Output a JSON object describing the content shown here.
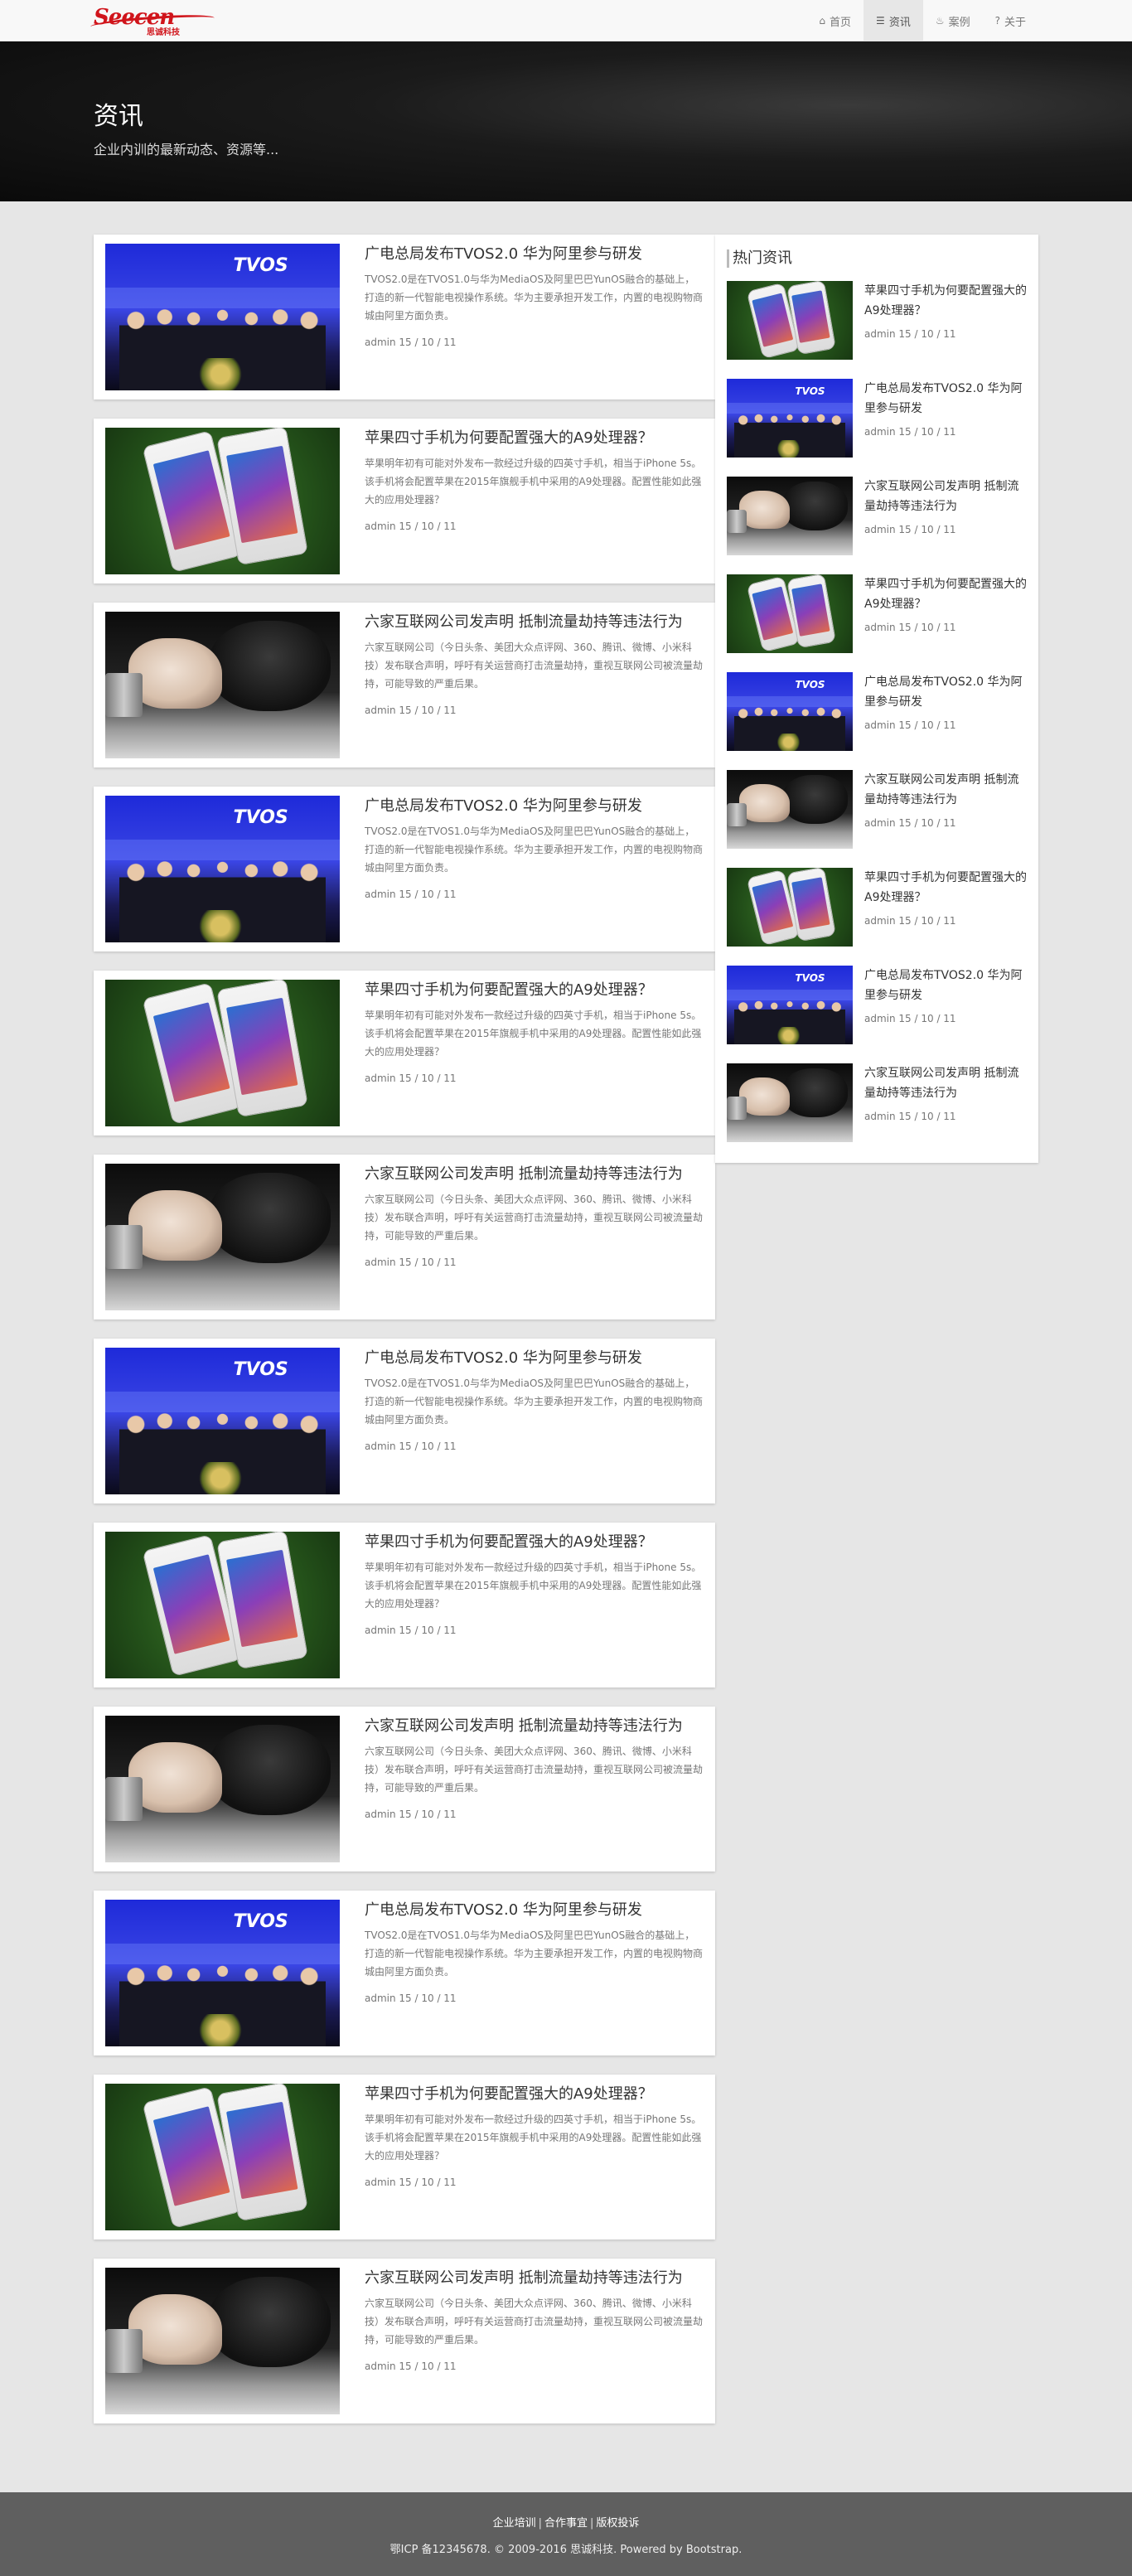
{
  "brand": {
    "logo_text": "Seecen",
    "logo_sub": "思诚科技"
  },
  "nav": [
    {
      "label": "首页",
      "icon": "home-icon",
      "glyph": "⌂"
    },
    {
      "label": "资讯",
      "icon": "list-icon",
      "glyph": "☰",
      "active": true
    },
    {
      "label": "案例",
      "icon": "fire-icon",
      "glyph": "♨"
    },
    {
      "label": "关于",
      "icon": "question-icon",
      "glyph": "?"
    }
  ],
  "hero": {
    "title": "资讯",
    "subtitle": "企业内训的最新动态、资源等..."
  },
  "articles": [
    {
      "image": "tv",
      "title": "广电总局发布TVOS2.0 华为阿里参与研发",
      "desc": "TVOS2.0是在TVOS1.0与华为MediaOS及阿里巴巴YunOS融合的基础上，打造的新一代智能电视操作系统。华为主要承担开发工作，内置的电视购物商城由阿里方面负责。",
      "meta": "admin 15 / 10 / 11"
    },
    {
      "image": "phone",
      "title": "苹果四寸手机为何要配置强大的A9处理器？",
      "desc": "苹果明年初有可能对外发布一款经过升级的四英寸手机，相当于iPhone 5s。该手机将会配置苹果在2015年旗舰手机中采用的A9处理器。配置性能如此强大的应用处理器？",
      "meta": "admin 15 / 10 / 11"
    },
    {
      "image": "hand",
      "title": "六家互联网公司发声明 抵制流量劫持等违法行为",
      "desc": "六家互联网公司（今日头条、美团大众点评网、360、腾讯、微博、小米科技）发布联合声明，呼吁有关运营商打击流量劫持，重视互联网公司被流量劫持，可能导致的严重后果。",
      "meta": "admin 15 / 10 / 11"
    },
    {
      "image": "tv",
      "title": "广电总局发布TVOS2.0 华为阿里参与研发",
      "desc": "TVOS2.0是在TVOS1.0与华为MediaOS及阿里巴巴YunOS融合的基础上，打造的新一代智能电视操作系统。华为主要承担开发工作，内置的电视购物商城由阿里方面负责。",
      "meta": "admin 15 / 10 / 11"
    },
    {
      "image": "phone",
      "title": "苹果四寸手机为何要配置强大的A9处理器？",
      "desc": "苹果明年初有可能对外发布一款经过升级的四英寸手机，相当于iPhone 5s。该手机将会配置苹果在2015年旗舰手机中采用的A9处理器。配置性能如此强大的应用处理器？",
      "meta": "admin 15 / 10 / 11"
    },
    {
      "image": "hand",
      "title": "六家互联网公司发声明 抵制流量劫持等违法行为",
      "desc": "六家互联网公司（今日头条、美团大众点评网、360、腾讯、微博、小米科技）发布联合声明，呼吁有关运营商打击流量劫持，重视互联网公司被流量劫持，可能导致的严重后果。",
      "meta": "admin 15 / 10 / 11"
    },
    {
      "image": "tv",
      "title": "广电总局发布TVOS2.0 华为阿里参与研发",
      "desc": "TVOS2.0是在TVOS1.0与华为MediaOS及阿里巴巴YunOS融合的基础上，打造的新一代智能电视操作系统。华为主要承担开发工作，内置的电视购物商城由阿里方面负责。",
      "meta": "admin 15 / 10 / 11"
    },
    {
      "image": "phone",
      "title": "苹果四寸手机为何要配置强大的A9处理器？",
      "desc": "苹果明年初有可能对外发布一款经过升级的四英寸手机，相当于iPhone 5s。该手机将会配置苹果在2015年旗舰手机中采用的A9处理器。配置性能如此强大的应用处理器？",
      "meta": "admin 15 / 10 / 11"
    },
    {
      "image": "hand",
      "title": "六家互联网公司发声明 抵制流量劫持等违法行为",
      "desc": "六家互联网公司（今日头条、美团大众点评网、360、腾讯、微博、小米科技）发布联合声明，呼吁有关运营商打击流量劫持，重视互联网公司被流量劫持，可能导致的严重后果。",
      "meta": "admin 15 / 10 / 11"
    },
    {
      "image": "tv",
      "title": "广电总局发布TVOS2.0 华为阿里参与研发",
      "desc": "TVOS2.0是在TVOS1.0与华为MediaOS及阿里巴巴YunOS融合的基础上，打造的新一代智能电视操作系统。华为主要承担开发工作，内置的电视购物商城由阿里方面负责。",
      "meta": "admin 15 / 10 / 11"
    },
    {
      "image": "phone",
      "title": "苹果四寸手机为何要配置强大的A9处理器？",
      "desc": "苹果明年初有可能对外发布一款经过升级的四英寸手机，相当于iPhone 5s。该手机将会配置苹果在2015年旗舰手机中采用的A9处理器。配置性能如此强大的应用处理器？",
      "meta": "admin 15 / 10 / 11"
    },
    {
      "image": "hand",
      "title": "六家互联网公司发声明 抵制流量劫持等违法行为",
      "desc": "六家互联网公司（今日头条、美团大众点评网、360、腾讯、微博、小米科技）发布联合声明，呼吁有关运营商打击流量劫持，重视互联网公司被流量劫持，可能导致的严重后果。",
      "meta": "admin 15 / 10 / 11"
    }
  ],
  "sidebar": {
    "title": "热门资讯",
    "items": [
      {
        "image": "phone",
        "title": "苹果四寸手机为何要配置强大的A9处理器？",
        "meta": "admin 15 / 10 / 11"
      },
      {
        "image": "tv",
        "title": "广电总局发布TVOS2.0 华为阿里参与研发",
        "meta": "admin 15 / 10 / 11"
      },
      {
        "image": "hand",
        "title": "六家互联网公司发声明 抵制流量劫持等违法行为",
        "meta": "admin 15 / 10 / 11"
      },
      {
        "image": "phone",
        "title": "苹果四寸手机为何要配置强大的A9处理器？",
        "meta": "admin 15 / 10 / 11"
      },
      {
        "image": "tv",
        "title": "广电总局发布TVOS2.0 华为阿里参与研发",
        "meta": "admin 15 / 10 / 11"
      },
      {
        "image": "hand",
        "title": "六家互联网公司发声明 抵制流量劫持等违法行为",
        "meta": "admin 15 / 10 / 11"
      },
      {
        "image": "phone",
        "title": "苹果四寸手机为何要配置强大的A9处理器？",
        "meta": "admin 15 / 10 / 11"
      },
      {
        "image": "tv",
        "title": "广电总局发布TVOS2.0 华为阿里参与研发",
        "meta": "admin 15 / 10 / 11"
      },
      {
        "image": "hand",
        "title": "六家互联网公司发声明 抵制流量劫持等违法行为",
        "meta": "admin 15 / 10 / 11"
      }
    ]
  },
  "footer": {
    "links": [
      "企业培训",
      "合作事宜",
      "版权投诉"
    ],
    "separator": "|",
    "copyright": "鄂ICP 备12345678. © 2009-2016 思诚科技. Powered by Bootstrap."
  }
}
